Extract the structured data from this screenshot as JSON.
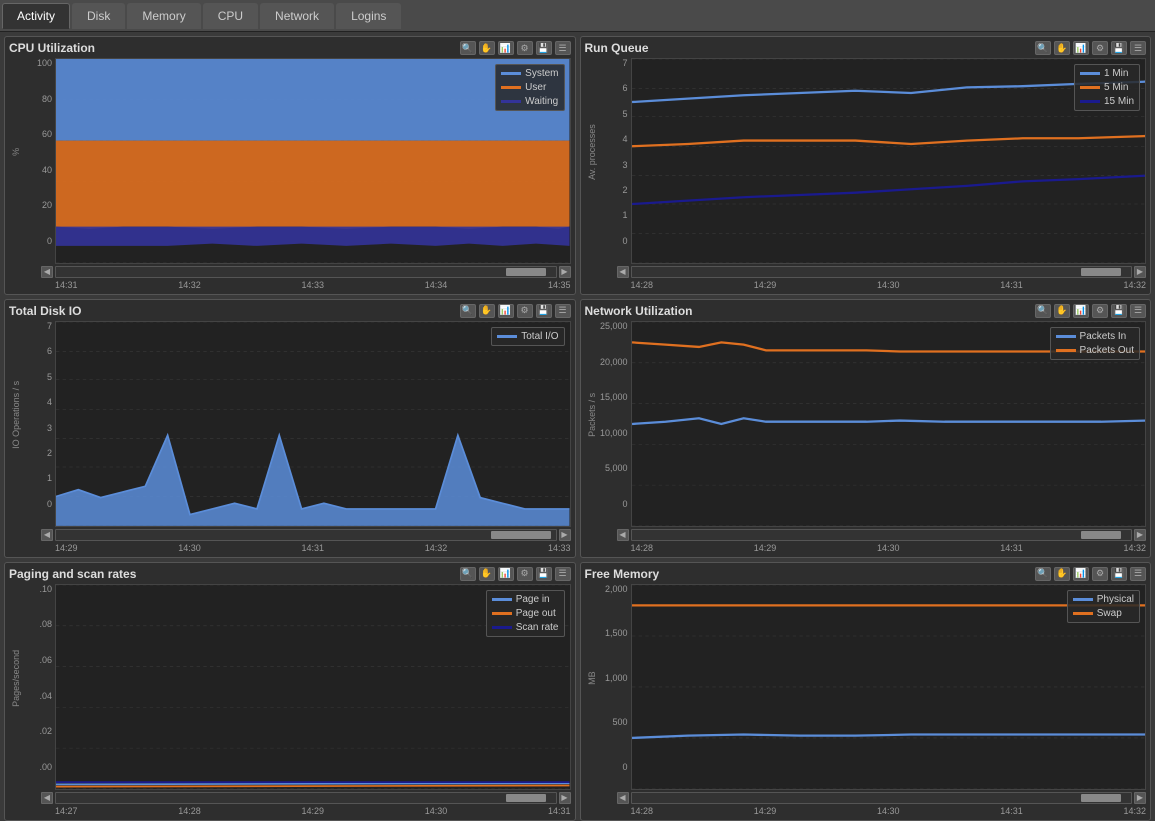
{
  "tabs": [
    {
      "label": "Activity",
      "active": true
    },
    {
      "label": "Disk",
      "active": false
    },
    {
      "label": "Memory",
      "active": false
    },
    {
      "label": "CPU",
      "active": false
    },
    {
      "label": "Network",
      "active": false
    },
    {
      "label": "Logins",
      "active": false
    }
  ],
  "panels": {
    "cpu_utilization": {
      "title": "CPU Utilization",
      "y_label": "%",
      "y_ticks": [
        "100",
        "80",
        "60",
        "40",
        "20",
        "0"
      ],
      "x_ticks": [
        "14:31",
        "14:32",
        "14:33",
        "14:34",
        "14:35"
      ],
      "legend": [
        {
          "label": "System",
          "color": "#5b8dd9"
        },
        {
          "label": "User",
          "color": "#e07020"
        },
        {
          "label": "Waiting",
          "color": "#333399"
        }
      ]
    },
    "run_queue": {
      "title": "Run Queue",
      "y_label": "Av. processes",
      "y_ticks": [
        "7",
        "6",
        "5",
        "4",
        "3",
        "2",
        "1",
        "0"
      ],
      "x_ticks": [
        "14:28",
        "14:29",
        "14:30",
        "14:31",
        "14:32"
      ],
      "legend": [
        {
          "label": "1 Min",
          "color": "#5b8dd9"
        },
        {
          "label": "5 Min",
          "color": "#e07020"
        },
        {
          "label": "15 Min",
          "color": "#1a1a6e"
        }
      ]
    },
    "total_disk_io": {
      "title": "Total Disk IO",
      "y_label": "IO Operations / s",
      "y_ticks": [
        "7",
        "6",
        "5",
        "4",
        "3",
        "2",
        "1",
        "0"
      ],
      "x_ticks": [
        "14:29",
        "14:30",
        "14:31",
        "14:32",
        "14:33"
      ],
      "legend": [
        {
          "label": "Total I/O",
          "color": "#5b8dd9"
        }
      ]
    },
    "network_utilization": {
      "title": "Network Utilization",
      "y_label": "Packets / s",
      "y_ticks": [
        "25,000",
        "20,000",
        "15,000",
        "10,000",
        "5,000",
        "0"
      ],
      "x_ticks": [
        "14:28",
        "14:29",
        "14:30",
        "14:31",
        "14:32"
      ],
      "legend": [
        {
          "label": "Packets In",
          "color": "#5b8dd9"
        },
        {
          "label": "Packets Out",
          "color": "#e07020"
        }
      ]
    },
    "paging": {
      "title": "Paging and scan rates",
      "y_label": "Pages/second",
      "y_ticks": [
        ".10",
        ".08",
        ".06",
        ".04",
        ".02",
        ".00"
      ],
      "x_ticks": [
        "14:27",
        "14:28",
        "14:29",
        "14:30",
        "14:31"
      ],
      "legend": [
        {
          "label": "Page in",
          "color": "#5b8dd9"
        },
        {
          "label": "Page out",
          "color": "#e07020"
        },
        {
          "label": "Scan rate",
          "color": "#1a1a6e"
        }
      ]
    },
    "free_memory": {
      "title": "Free Memory",
      "y_label": "MB",
      "y_ticks": [
        "2,000",
        "1,500",
        "1,000",
        "500",
        "0"
      ],
      "x_ticks": [
        "14:28",
        "14:29",
        "14:30",
        "14:31",
        "14:32"
      ],
      "legend": [
        {
          "label": "Physical",
          "color": "#5b8dd9"
        },
        {
          "label": "Swap",
          "color": "#e07020"
        }
      ]
    }
  },
  "icons": {
    "zoom": "🔍",
    "hand": "✋",
    "chart": "📈",
    "filter": "⚙",
    "save": "💾",
    "menu": "☰",
    "left": "◀",
    "right": "▶"
  }
}
